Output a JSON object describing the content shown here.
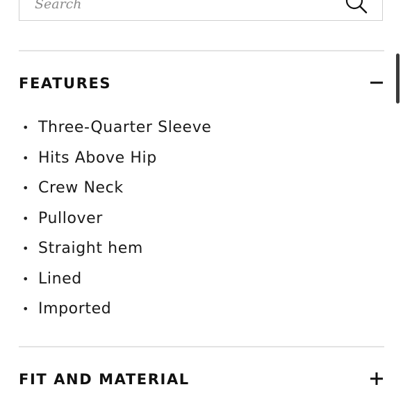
{
  "search": {
    "placeholder": "Search",
    "icon": "search-icon"
  },
  "features": {
    "title": "FEATURES",
    "expanded": true,
    "toggle_icon": "minus-icon",
    "items": [
      {
        "label": "Three-Quarter Sleeve",
        "bullet": "•"
      },
      {
        "label": "Hits Above Hip",
        "bullet": "•"
      },
      {
        "label": "Crew Neck",
        "bullet": "•"
      },
      {
        "label": "Pullover",
        "bullet": "•"
      },
      {
        "label": "Straight hem",
        "bullet": "•"
      },
      {
        "label": "Lined",
        "bullet": "•"
      },
      {
        "label": "Imported",
        "bullet": "•"
      }
    ]
  },
  "fit_and_material": {
    "title": "FIT AND MATERIAL",
    "expanded": false,
    "toggle_icon": "plus-icon"
  },
  "colors": {
    "text": "#111111",
    "divider": "#e3e3e3",
    "search_border": "#cfcfcf",
    "placeholder": "#8a8a8a",
    "scrollbar": "#3a3a3a"
  }
}
